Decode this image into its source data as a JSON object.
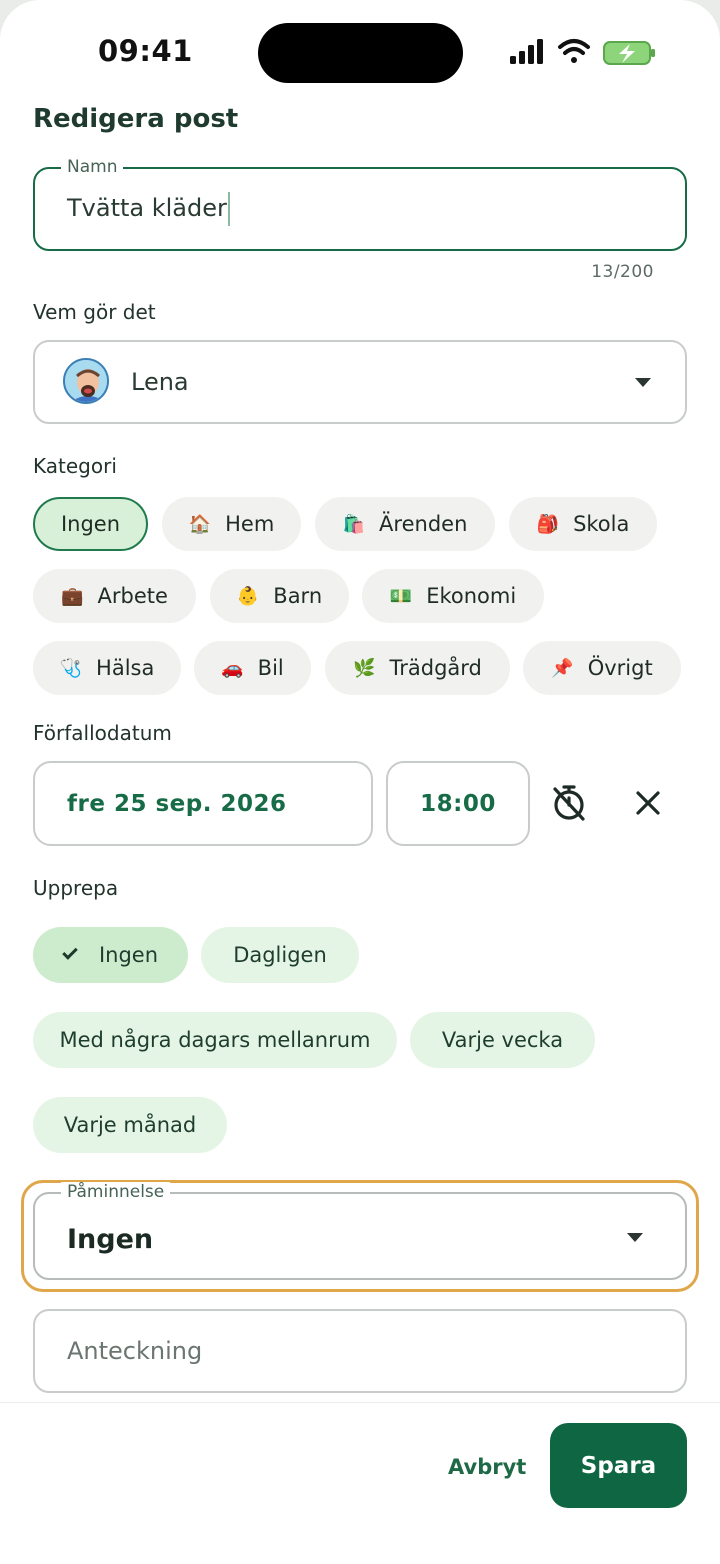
{
  "status_bar": {
    "time": "09:41"
  },
  "header": {
    "title": "Redigera post"
  },
  "name_field": {
    "label": "Namn",
    "value": "Tvätta kläder",
    "counter": "13/200"
  },
  "assignee": {
    "label": "Vem gör det",
    "value": "Lena"
  },
  "category": {
    "label": "Kategori",
    "chips": [
      {
        "label": "Ingen",
        "icon": "",
        "selected": true
      },
      {
        "label": "Hem",
        "icon": "🏠"
      },
      {
        "label": "Ärenden",
        "icon": "🛍️"
      },
      {
        "label": "Skola",
        "icon": "🎒"
      },
      {
        "label": "Arbete",
        "icon": "💼"
      },
      {
        "label": "Barn",
        "icon": "👶"
      },
      {
        "label": "Ekonomi",
        "icon": "💵"
      },
      {
        "label": "Hälsa",
        "icon": "🩺"
      },
      {
        "label": "Bil",
        "icon": "🚗"
      },
      {
        "label": "Trädgård",
        "icon": "🌿"
      },
      {
        "label": "Övrigt",
        "icon": "📌"
      }
    ]
  },
  "due": {
    "label": "Förfallodatum",
    "date": "fre 25 sep. 2026",
    "time": "18:00"
  },
  "repeat": {
    "label": "Upprepa",
    "options": [
      {
        "label": "Ingen",
        "selected": true
      },
      {
        "label": "Dagligen"
      },
      {
        "label": "Med några dagars mellanrum"
      },
      {
        "label": "Varje vecka"
      },
      {
        "label": "Varje månad"
      }
    ]
  },
  "reminder": {
    "label": "Påminnelse",
    "value": "Ingen"
  },
  "note": {
    "placeholder": "Anteckning"
  },
  "actions": {
    "cancel": "Avbryt",
    "save": "Spara"
  },
  "colors": {
    "primary": "#0f6643",
    "accent_highlight": "#e0a74a",
    "chip_selected_bg": "#d8f0d8",
    "repeat_chip_bg": "#e5f5e5"
  }
}
